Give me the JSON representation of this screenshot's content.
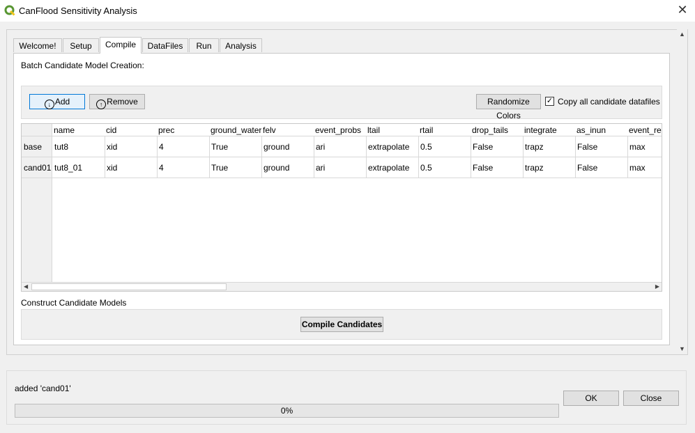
{
  "window": {
    "title": "CanFlood Sensitivity Analysis"
  },
  "tabs": [
    {
      "label": "Welcome!"
    },
    {
      "label": "Setup"
    },
    {
      "label": "Compile"
    },
    {
      "label": "DataFiles"
    },
    {
      "label": "Run"
    },
    {
      "label": "Analysis"
    }
  ],
  "active_tab": "Compile",
  "compile": {
    "batch_label": "Batch Candidate Model Creation:",
    "add_label": "Add",
    "remove_label": "Remove",
    "randomize_label": "Randomize Colors",
    "copy_label": "Copy all candidate datafiles",
    "copy_checked": true,
    "construct_label": "Construct Candidate Models",
    "compile_label": "Compile Candidates"
  },
  "table": {
    "columns": [
      "name",
      "cid",
      "prec",
      "ground_water",
      "felv",
      "event_probs",
      "ltail",
      "rtail",
      "drop_tails",
      "integrate",
      "as_inun",
      "event_rels"
    ],
    "rows": [
      {
        "header": "base",
        "cells": [
          "tut8",
          "xid",
          "4",
          "True",
          "ground",
          "ari",
          "extrapolate",
          "0.5",
          "False",
          "trapz",
          "False",
          "max"
        ]
      },
      {
        "header": "cand01",
        "cells": [
          "tut8_01",
          "xid",
          "4",
          "True",
          "ground",
          "ari",
          "extrapolate",
          "0.5",
          "False",
          "trapz",
          "False",
          "max"
        ]
      }
    ]
  },
  "status": {
    "message": "added 'cand01'",
    "progress_text": "0%",
    "progress_value": 0
  },
  "buttons": {
    "ok": "OK",
    "close": "Close"
  },
  "colors": {
    "accent": "#0078d7",
    "qgis_green": "#589632"
  }
}
